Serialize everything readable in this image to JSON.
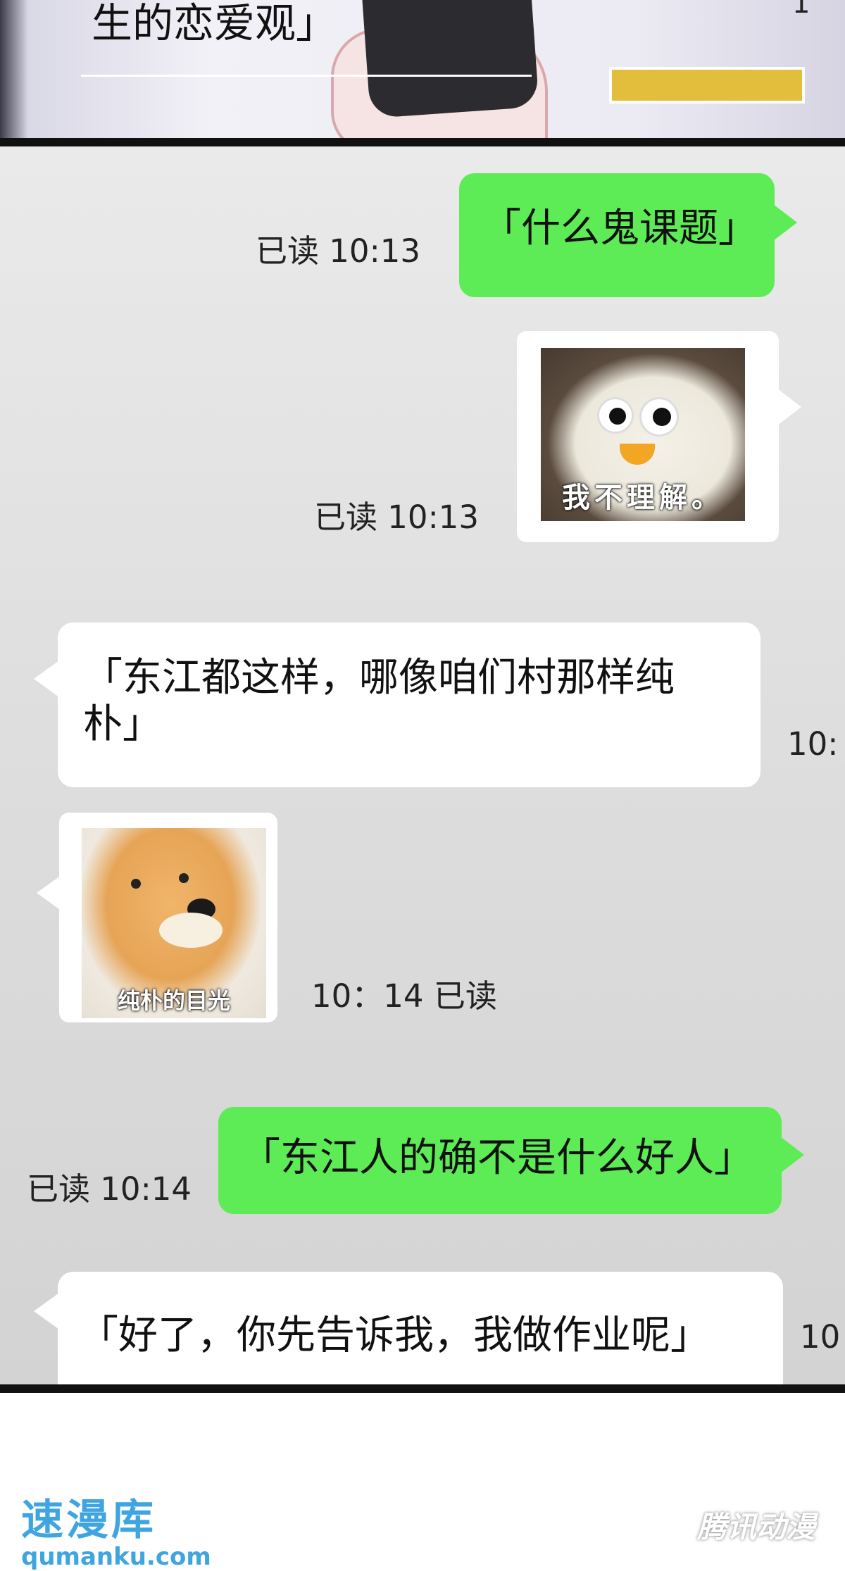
{
  "top_panel": {
    "caption": "生的恋爱观」",
    "corner_text": "1"
  },
  "messages": [
    {
      "id": "m1",
      "side": "right",
      "kind": "text",
      "text": "「什么鬼课题」",
      "meta": "已读  10:13"
    },
    {
      "id": "m2",
      "side": "right",
      "kind": "sticker",
      "sticker_caption": "我不理解。",
      "meta": "已读 10:13"
    },
    {
      "id": "m3",
      "side": "left",
      "kind": "text",
      "text_line1": "「东江都这样，哪像咱们村那样纯",
      "text_line2": "朴」",
      "meta": "10:"
    },
    {
      "id": "m4",
      "side": "left",
      "kind": "sticker",
      "sticker_caption": "纯朴的目光",
      "meta": "10：14 已读"
    },
    {
      "id": "m5",
      "side": "right",
      "kind": "text",
      "text": "「东江人的确不是什么好人」",
      "meta": "已读 10:14"
    },
    {
      "id": "m6",
      "side": "left",
      "kind": "text",
      "text": "「好了，你先告诉我，我做作业呢」",
      "meta": "10"
    }
  ],
  "watermark": {
    "site_name": "速漫库",
    "site_url": "qumanku.com",
    "publisher": "腾讯动漫"
  },
  "colors": {
    "green_bubble": "#5deb56",
    "white_bubble": "#ffffff",
    "watermark_blue": "#3fa5e0"
  }
}
